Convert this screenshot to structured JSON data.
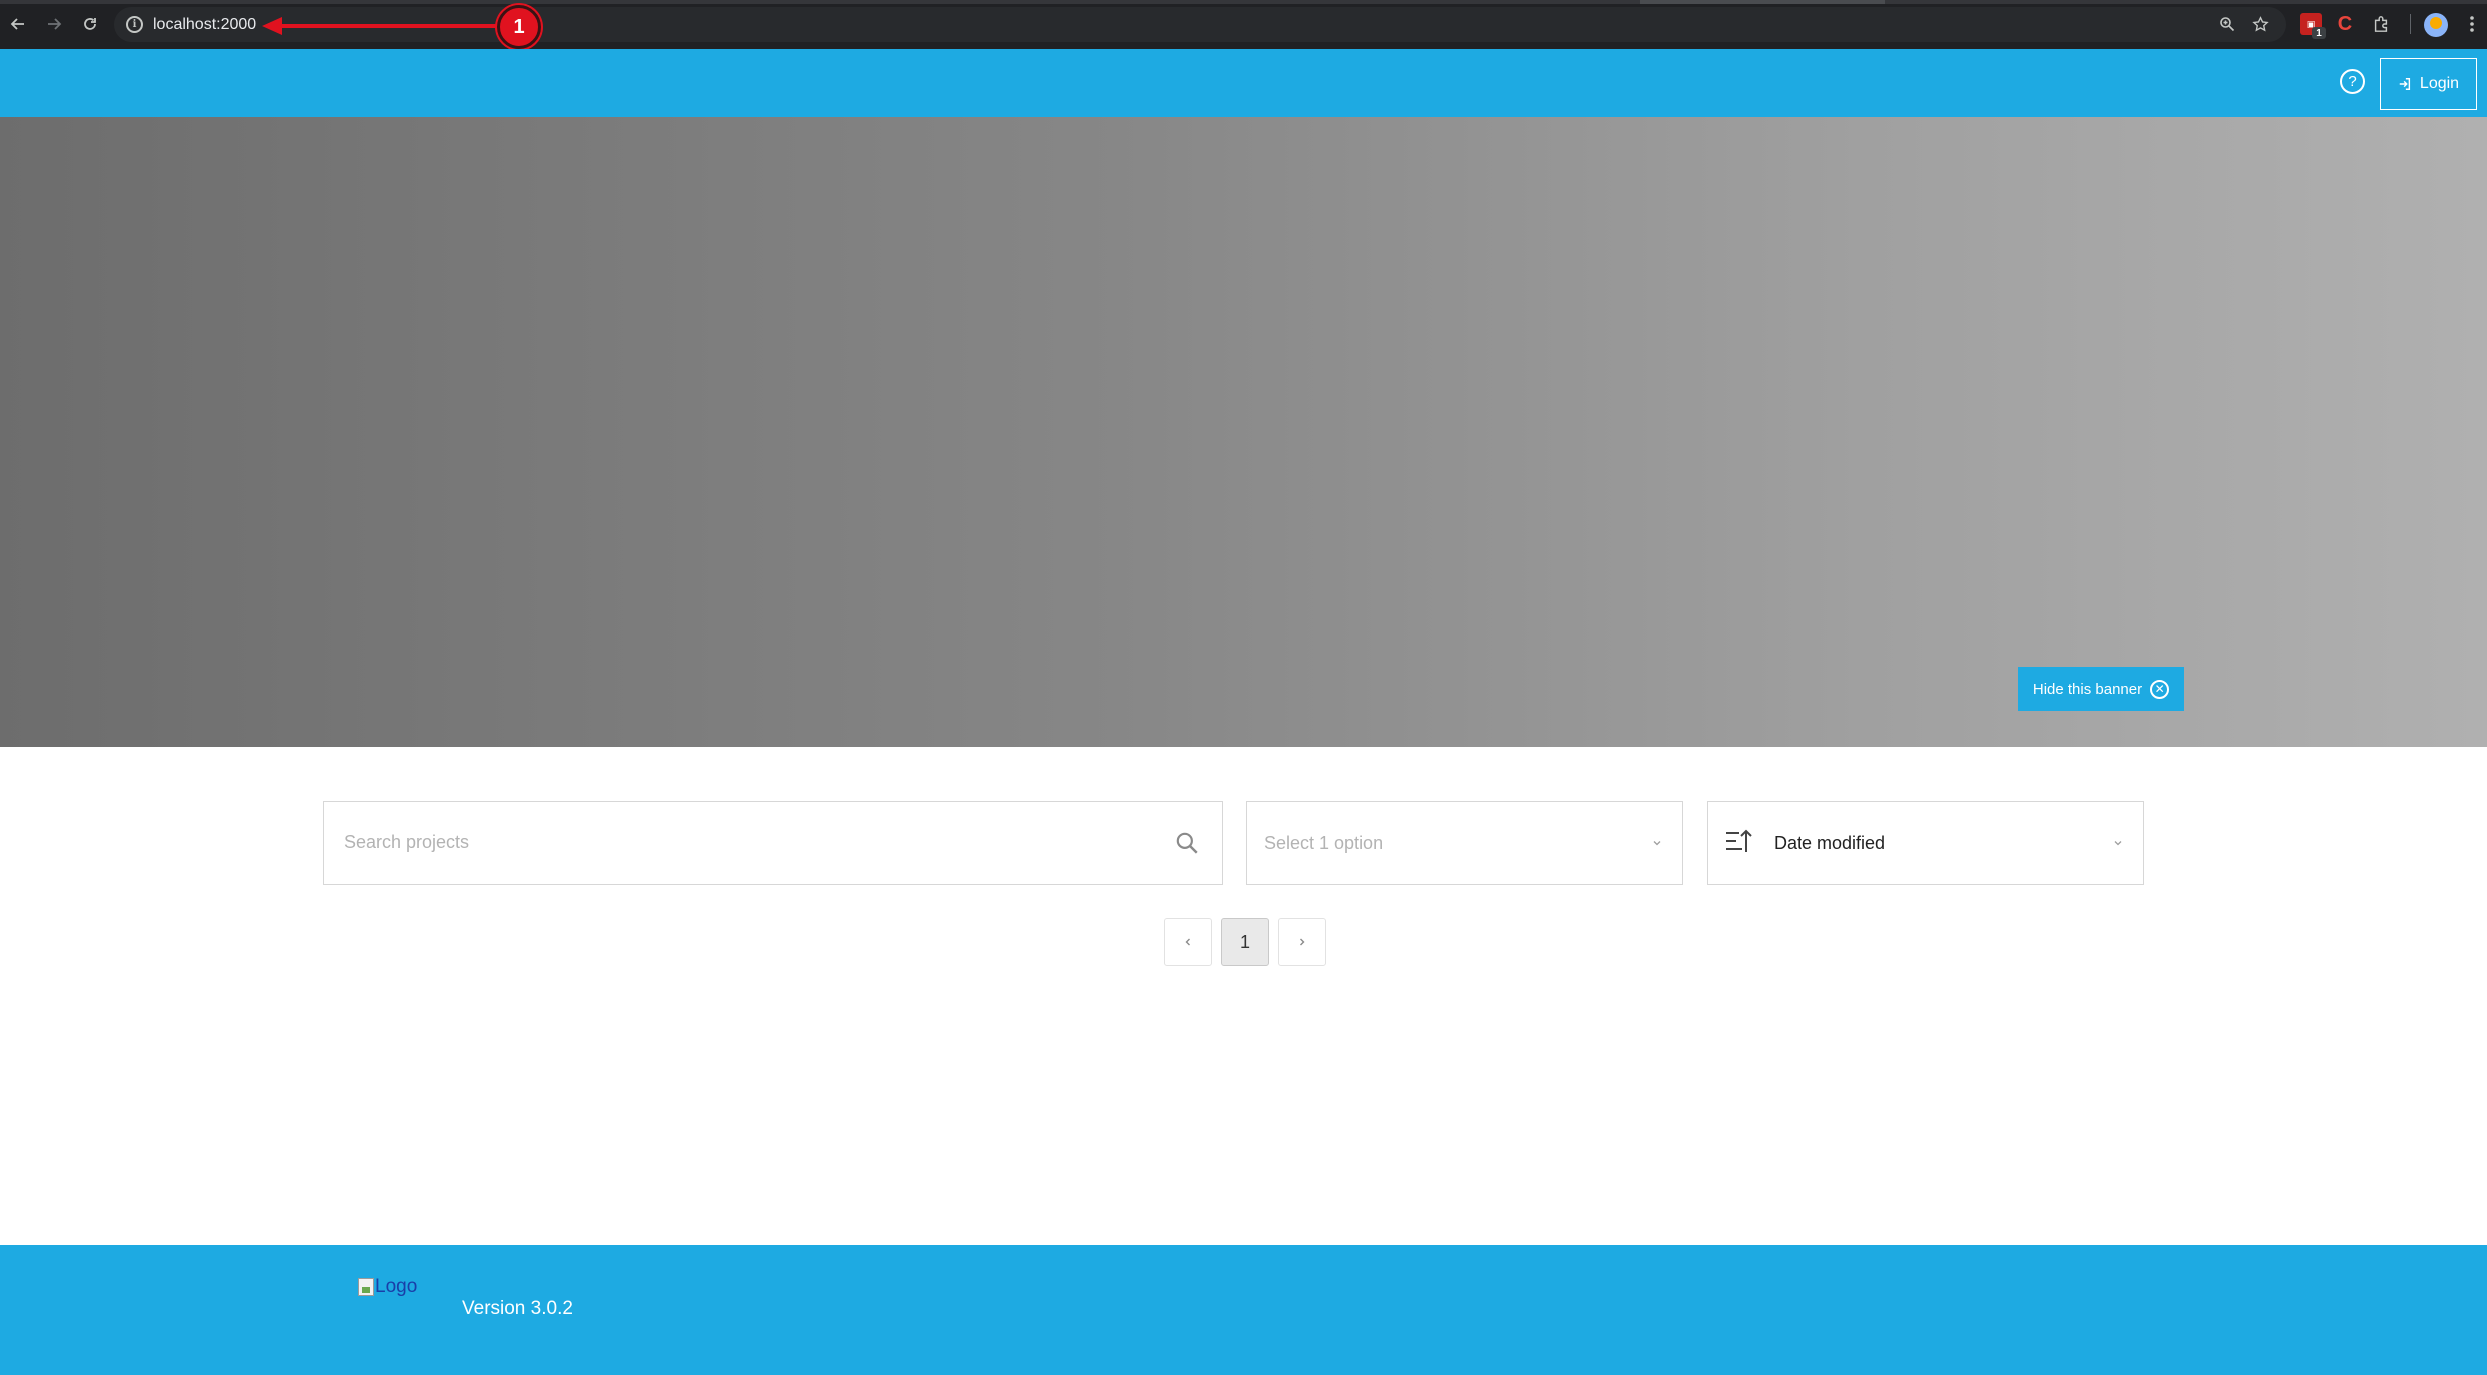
{
  "browser": {
    "url": "localhost:2000",
    "extension_badge": "1",
    "extension_letter": "C"
  },
  "annotation": {
    "marker": "1"
  },
  "header": {
    "help_label": "?",
    "login_label": "Login"
  },
  "banner": {
    "hide_label": "Hide this banner"
  },
  "filters": {
    "search_placeholder": "Search projects",
    "category_placeholder": "Select 1 option",
    "sort_value": "Date modified"
  },
  "pagination": {
    "current_page": "1"
  },
  "footer": {
    "logo_alt": "Logo",
    "version": "Version 3.0.2"
  },
  "colors": {
    "brand": "#1eaae2",
    "annotation": "#e0121f"
  }
}
